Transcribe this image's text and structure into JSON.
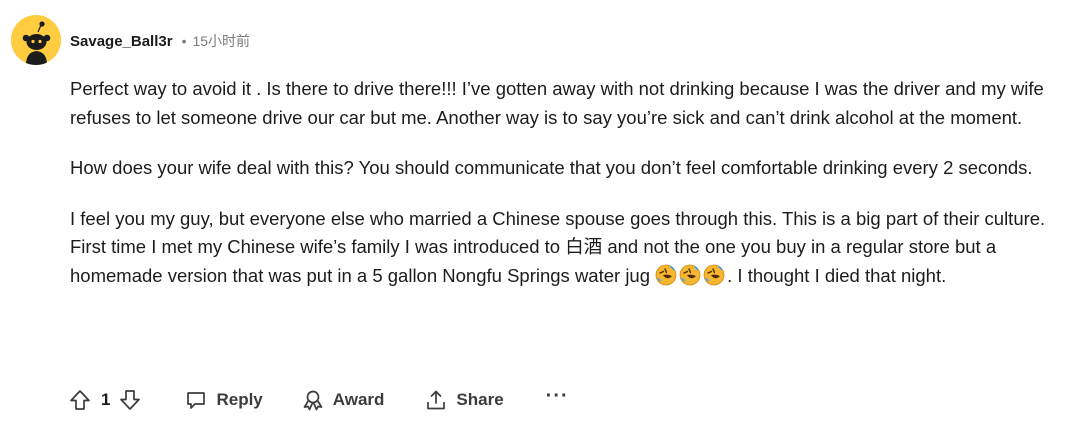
{
  "comment": {
    "username": "Savage_Ball3r",
    "separator": "•",
    "timestamp": "15小时前",
    "paragraphs": {
      "p1": "Perfect way to avoid it . Is there to drive there!!! I’ve gotten away with not drinking because I was the driver and my wife refuses to let someone drive our car but me. Another way is to say you’re sick and can’t drink alcohol at the moment.",
      "p2": "How does your wife deal with this? You should communicate that you don’t feel comfortable drinking every 2 seconds.",
      "p3_before_emoji": "I feel you my guy, but everyone else who married a Chinese spouse goes through this. This is a big part of their culture. First time I met my Chinese wife’s family I was introduced to 白酒 and not the one you buy in a regular store but a homemade version that was put in a 5 gallon Nongfu Springs water jug ",
      "p3_after_emoji": ". I thought I died that night."
    },
    "emoji_icon": "rolling-on-floor-laughing-emoji",
    "emoji_count": 3
  },
  "actions": {
    "vote_count": "1",
    "reply_label": "Reply",
    "award_label": "Award",
    "share_label": "Share",
    "more_label": "···"
  },
  "colors": {
    "avatar_bg": "#ffcd3f",
    "text": "#1c1c1c",
    "meta": "#7c7c7c",
    "action_text": "#3c3c3c"
  }
}
